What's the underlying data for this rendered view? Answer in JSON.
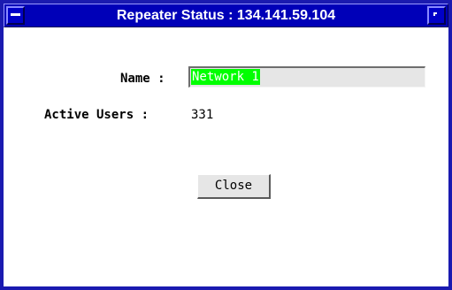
{
  "window": {
    "title": "Repeater Status : 134.141.59.104",
    "menu_icon": "window-menu-icon",
    "maximize_icon": "maximize-icon"
  },
  "form": {
    "name_label": "Name :",
    "name_value": "Network 1",
    "active_users_label": "Active Users :",
    "active_users_value": "331"
  },
  "buttons": {
    "close_label": "Close"
  },
  "colors": {
    "title_bar": "#0000b8",
    "selection_highlight": "#00ff00",
    "field_background": "#e6e6e6"
  }
}
